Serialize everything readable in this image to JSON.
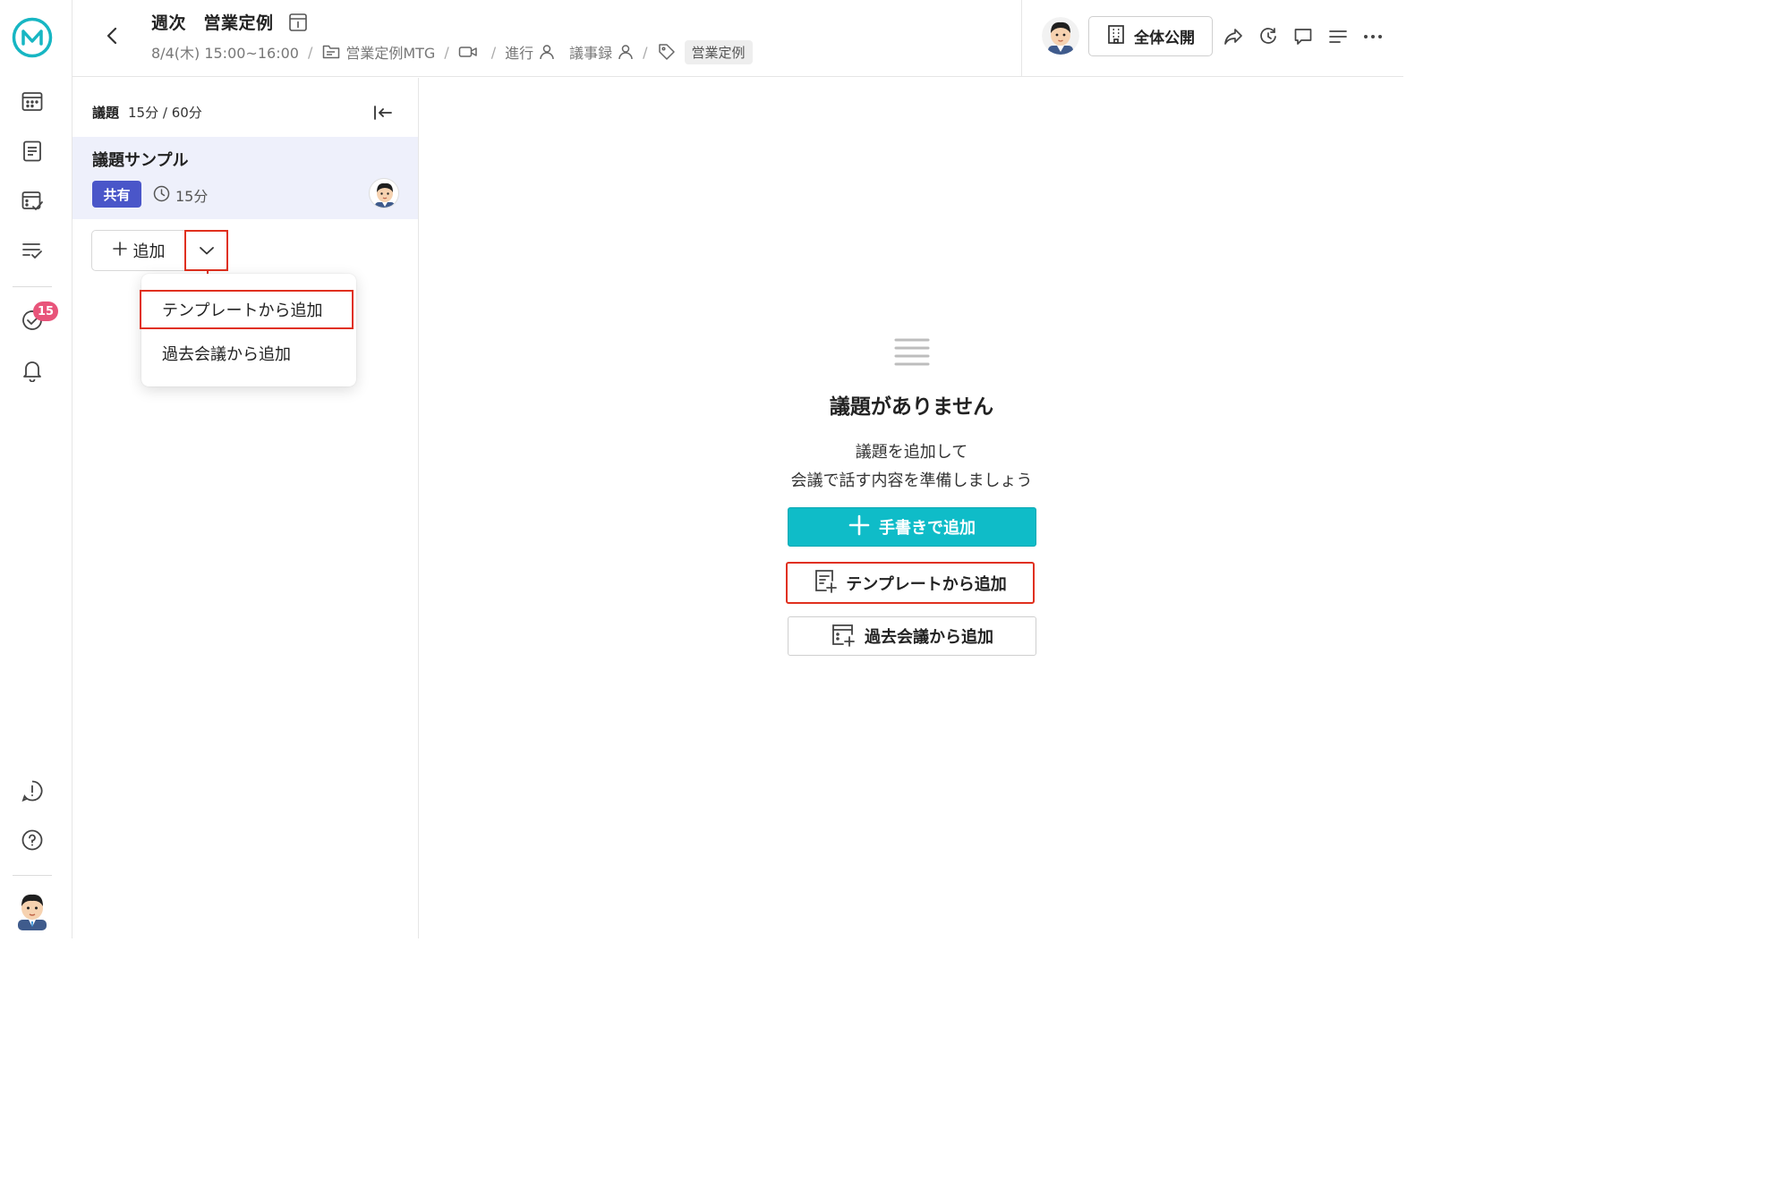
{
  "header": {
    "title": "週次　営業定例",
    "date_time": "8/4(木) 15:00~16:00",
    "folder": "営業定例MTG",
    "facilitator_label": "進行",
    "minutes_label": "議事録",
    "tag": "営業定例",
    "separator": "/",
    "public_label": "全体公開"
  },
  "rail": {
    "badge_count": "15"
  },
  "agenda": {
    "label": "議題",
    "time_summary": "15分 / 60分",
    "items": [
      {
        "name": "議題サンプル",
        "badge": "共有",
        "duration": "15分"
      }
    ],
    "add_label": "追加",
    "dropdown": [
      "テンプレートから追加",
      "過去会議から追加"
    ]
  },
  "empty": {
    "title": "議題がありません",
    "desc_line1": "議題を追加して",
    "desc_line2": "会議で話す内容を準備しましょう",
    "btn_manual": "手書きで追加",
    "btn_template": "テンプレートから追加",
    "btn_past": "過去会議から追加"
  },
  "colors": {
    "accent": "#0fbcc8",
    "share_badge": "#4a56c9",
    "highlight": "#e0301e",
    "notification_badge": "#e8547a",
    "logo": "#17b6c3"
  },
  "icons": [
    "logo-icon",
    "calendar-icon",
    "document-icon",
    "task-board-icon",
    "checklist-icon",
    "check-circle-icon",
    "bell-icon",
    "feedback-icon",
    "help-icon",
    "back-icon",
    "info-panel-icon",
    "folder-icon",
    "video-icon",
    "person-icon",
    "tag-icon",
    "building-icon",
    "share-icon",
    "refresh-icon",
    "comment-icon",
    "menu-icon",
    "more-icon",
    "collapse-icon",
    "clock-icon",
    "chevron-down-icon",
    "plus-icon",
    "template-icon",
    "past-meeting-icon",
    "list-lines-icon"
  ]
}
